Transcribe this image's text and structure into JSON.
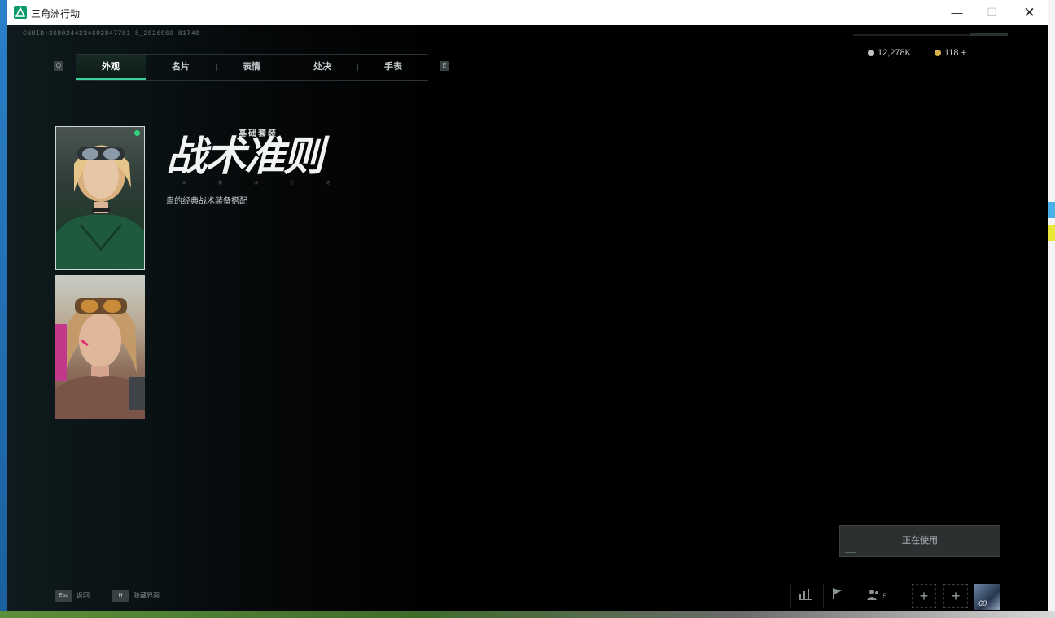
{
  "window": {
    "title": "三角洲行动",
    "min_glyph": "—",
    "max_glyph": "☐",
    "close_glyph": "✕"
  },
  "game": {
    "uid": "CNUID:3680244234602847781 8_2026060 81740",
    "tabs": [
      {
        "label": "外观",
        "active": true
      },
      {
        "label": "名片",
        "active": false
      },
      {
        "label": "表情",
        "active": false
      },
      {
        "label": "处决",
        "active": false
      },
      {
        "label": "手表",
        "active": false
      }
    ],
    "tab_prev_key": "Q",
    "tab_next_key": "E",
    "currency": [
      {
        "value": "12,278K",
        "color": "#bfc3c4",
        "icon": "silver-coin-icon"
      },
      {
        "value": "118 +",
        "color": "#d8b24a",
        "icon": "gold-coin-icon"
      }
    ],
    "skin": {
      "category": "基础套装",
      "name": "战术准则",
      "dots_text": [
        "三",
        "角",
        "洲",
        "行",
        "动"
      ],
      "description": "蛊的经典战术装备搭配"
    },
    "use_button": "正在使用",
    "hints": [
      {
        "key": "Esc",
        "label": "返回"
      },
      {
        "key": "H",
        "label": "隐藏界面"
      }
    ],
    "squad_count": "5",
    "player_level": "60",
    "accent": "#3ad29a"
  }
}
